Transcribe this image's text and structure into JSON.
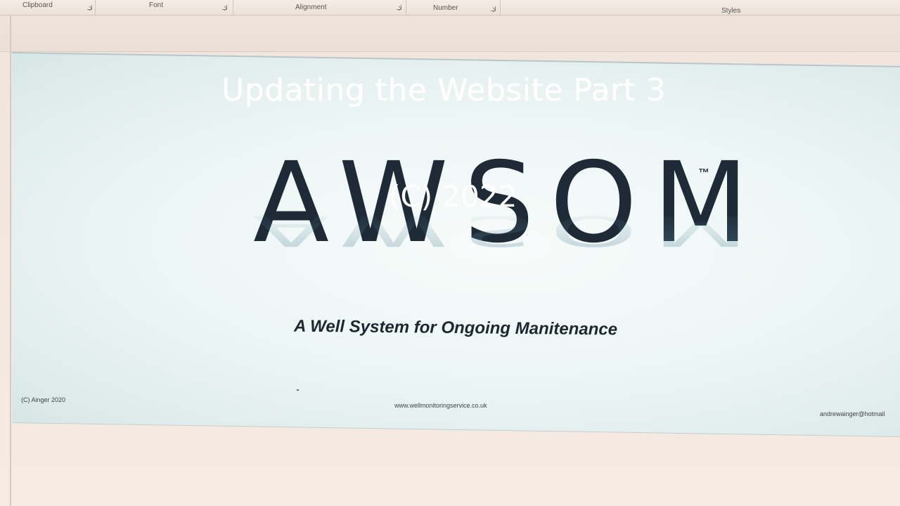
{
  "ribbon": {
    "groups": [
      {
        "label": "Clipboard",
        "launcher": true
      },
      {
        "label": "Font",
        "launcher": true
      },
      {
        "label": "Alignment",
        "launcher": true
      },
      {
        "label": "Number",
        "launcher": true
      },
      {
        "label": "Styles",
        "launcher": false
      }
    ]
  },
  "overlay": {
    "title": "Updating the Website Part 3",
    "year": "(C) 2022"
  },
  "banner": {
    "logo_text": "AWSOM",
    "trademark": "™",
    "tagline": "A Well System for Ongoing Manitenance",
    "copyright": "(C) Ainger 2020",
    "website": "www.wellmonitoringservice.co.uk",
    "email": "andrewainger@hotmail"
  },
  "colors": {
    "logo": "#1e2b36",
    "banner_bg": "#eef7f6",
    "overlay_text": "#ffffff"
  }
}
